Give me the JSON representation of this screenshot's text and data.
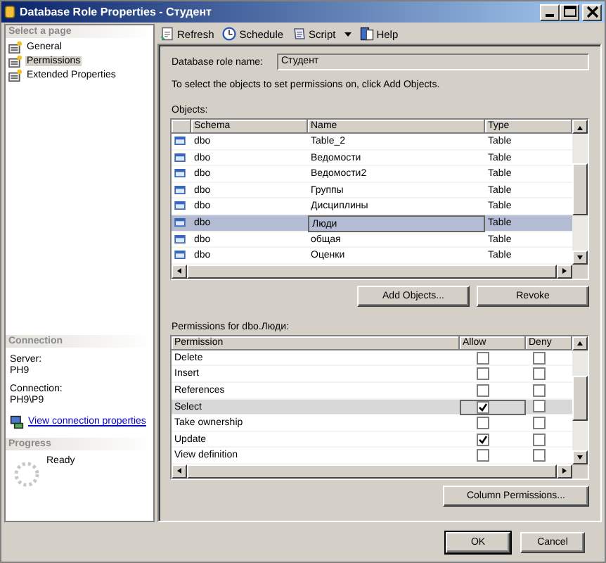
{
  "window": {
    "title": "Database Role Properties - Студент"
  },
  "sidebar": {
    "heading": "Select a page",
    "items": [
      {
        "label": "General",
        "selected": false
      },
      {
        "label": "Permissions",
        "selected": true
      },
      {
        "label": "Extended Properties",
        "selected": false
      }
    ],
    "connection": {
      "heading": "Connection",
      "server_label": "Server:",
      "server": "PH9",
      "connection_label": "Connection:",
      "connection": "PH9\\P9",
      "link": "View connection properties"
    },
    "progress": {
      "heading": "Progress",
      "status": "Ready"
    }
  },
  "toolbar": [
    {
      "label": "Refresh",
      "kind": "refresh",
      "has_menu": false
    },
    {
      "label": "Schedule",
      "kind": "schedule",
      "has_menu": false
    },
    {
      "label": "Script",
      "kind": "script",
      "has_menu": true
    },
    {
      "label": "Help",
      "kind": "help",
      "has_menu": false
    }
  ],
  "role_name": {
    "label": "Database role name:",
    "value": "Студент"
  },
  "instruction": "To select the objects to set permissions on, click Add Objects.",
  "objects": {
    "label": "Objects:",
    "columns": [
      "Schema",
      "Name",
      "Type"
    ],
    "rows": [
      {
        "schema": "dbo",
        "name": "Table_2",
        "type": "Table",
        "selected": false
      },
      {
        "schema": "dbo",
        "name": "Ведомости",
        "type": "Table",
        "selected": false
      },
      {
        "schema": "dbo",
        "name": "Ведомости2",
        "type": "Table",
        "selected": false
      },
      {
        "schema": "dbo",
        "name": "Группы",
        "type": "Table",
        "selected": false
      },
      {
        "schema": "dbo",
        "name": "Дисциплины",
        "type": "Table",
        "selected": false
      },
      {
        "schema": "dbo",
        "name": "Люди",
        "type": "Table",
        "selected": true
      },
      {
        "schema": "dbo",
        "name": "общая",
        "type": "Table",
        "selected": false
      },
      {
        "schema": "dbo",
        "name": "Оценки",
        "type": "Table",
        "selected": false
      }
    ],
    "buttons": [
      "Add Objects...",
      "Revoke"
    ]
  },
  "permissions": {
    "label": "Permissions for dbo.Люди:",
    "columns": [
      "Permission",
      "Allow",
      "Deny"
    ],
    "rows": [
      {
        "permission": "Delete",
        "allow": false,
        "deny": false,
        "selected": false
      },
      {
        "permission": "Insert",
        "allow": false,
        "deny": false,
        "selected": false
      },
      {
        "permission": "References",
        "allow": false,
        "deny": false,
        "selected": false
      },
      {
        "permission": "Select",
        "allow": true,
        "deny": false,
        "selected": true
      },
      {
        "permission": "Take ownership",
        "allow": false,
        "deny": false,
        "selected": false
      },
      {
        "permission": "Update",
        "allow": true,
        "deny": false,
        "selected": false
      },
      {
        "permission": "View definition",
        "allow": false,
        "deny": false,
        "selected": false
      }
    ],
    "button": "Column Permissions..."
  },
  "dialog_buttons": [
    "OK",
    "Cancel"
  ]
}
